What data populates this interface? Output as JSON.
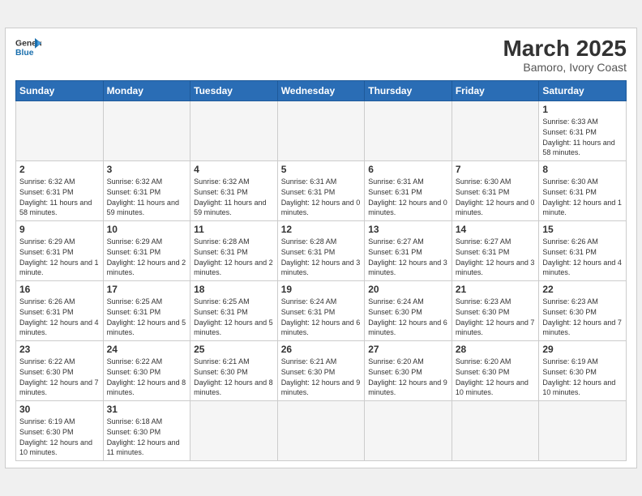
{
  "header": {
    "logo_general": "General",
    "logo_blue": "Blue",
    "month_title": "March 2025",
    "subtitle": "Bamoro, Ivory Coast"
  },
  "days_of_week": [
    "Sunday",
    "Monday",
    "Tuesday",
    "Wednesday",
    "Thursday",
    "Friday",
    "Saturday"
  ],
  "weeks": [
    [
      {
        "day": "",
        "empty": true
      },
      {
        "day": "",
        "empty": true
      },
      {
        "day": "",
        "empty": true
      },
      {
        "day": "",
        "empty": true
      },
      {
        "day": "",
        "empty": true
      },
      {
        "day": "",
        "empty": true
      },
      {
        "day": "1",
        "sunrise": "6:33 AM",
        "sunset": "6:31 PM",
        "daylight": "11 hours and 58 minutes."
      }
    ],
    [
      {
        "day": "2",
        "sunrise": "6:32 AM",
        "sunset": "6:31 PM",
        "daylight": "11 hours and 58 minutes."
      },
      {
        "day": "3",
        "sunrise": "6:32 AM",
        "sunset": "6:31 PM",
        "daylight": "11 hours and 59 minutes."
      },
      {
        "day": "4",
        "sunrise": "6:32 AM",
        "sunset": "6:31 PM",
        "daylight": "11 hours and 59 minutes."
      },
      {
        "day": "5",
        "sunrise": "6:31 AM",
        "sunset": "6:31 PM",
        "daylight": "12 hours and 0 minutes."
      },
      {
        "day": "6",
        "sunrise": "6:31 AM",
        "sunset": "6:31 PM",
        "daylight": "12 hours and 0 minutes."
      },
      {
        "day": "7",
        "sunrise": "6:30 AM",
        "sunset": "6:31 PM",
        "daylight": "12 hours and 0 minutes."
      },
      {
        "day": "8",
        "sunrise": "6:30 AM",
        "sunset": "6:31 PM",
        "daylight": "12 hours and 1 minute."
      }
    ],
    [
      {
        "day": "9",
        "sunrise": "6:29 AM",
        "sunset": "6:31 PM",
        "daylight": "12 hours and 1 minute."
      },
      {
        "day": "10",
        "sunrise": "6:29 AM",
        "sunset": "6:31 PM",
        "daylight": "12 hours and 2 minutes."
      },
      {
        "day": "11",
        "sunrise": "6:28 AM",
        "sunset": "6:31 PM",
        "daylight": "12 hours and 2 minutes."
      },
      {
        "day": "12",
        "sunrise": "6:28 AM",
        "sunset": "6:31 PM",
        "daylight": "12 hours and 3 minutes."
      },
      {
        "day": "13",
        "sunrise": "6:27 AM",
        "sunset": "6:31 PM",
        "daylight": "12 hours and 3 minutes."
      },
      {
        "day": "14",
        "sunrise": "6:27 AM",
        "sunset": "6:31 PM",
        "daylight": "12 hours and 3 minutes."
      },
      {
        "day": "15",
        "sunrise": "6:26 AM",
        "sunset": "6:31 PM",
        "daylight": "12 hours and 4 minutes."
      }
    ],
    [
      {
        "day": "16",
        "sunrise": "6:26 AM",
        "sunset": "6:31 PM",
        "daylight": "12 hours and 4 minutes."
      },
      {
        "day": "17",
        "sunrise": "6:25 AM",
        "sunset": "6:31 PM",
        "daylight": "12 hours and 5 minutes."
      },
      {
        "day": "18",
        "sunrise": "6:25 AM",
        "sunset": "6:31 PM",
        "daylight": "12 hours and 5 minutes."
      },
      {
        "day": "19",
        "sunrise": "6:24 AM",
        "sunset": "6:31 PM",
        "daylight": "12 hours and 6 minutes."
      },
      {
        "day": "20",
        "sunrise": "6:24 AM",
        "sunset": "6:30 PM",
        "daylight": "12 hours and 6 minutes."
      },
      {
        "day": "21",
        "sunrise": "6:23 AM",
        "sunset": "6:30 PM",
        "daylight": "12 hours and 7 minutes."
      },
      {
        "day": "22",
        "sunrise": "6:23 AM",
        "sunset": "6:30 PM",
        "daylight": "12 hours and 7 minutes."
      }
    ],
    [
      {
        "day": "23",
        "sunrise": "6:22 AM",
        "sunset": "6:30 PM",
        "daylight": "12 hours and 7 minutes."
      },
      {
        "day": "24",
        "sunrise": "6:22 AM",
        "sunset": "6:30 PM",
        "daylight": "12 hours and 8 minutes."
      },
      {
        "day": "25",
        "sunrise": "6:21 AM",
        "sunset": "6:30 PM",
        "daylight": "12 hours and 8 minutes."
      },
      {
        "day": "26",
        "sunrise": "6:21 AM",
        "sunset": "6:30 PM",
        "daylight": "12 hours and 9 minutes."
      },
      {
        "day": "27",
        "sunrise": "6:20 AM",
        "sunset": "6:30 PM",
        "daylight": "12 hours and 9 minutes."
      },
      {
        "day": "28",
        "sunrise": "6:20 AM",
        "sunset": "6:30 PM",
        "daylight": "12 hours and 10 minutes."
      },
      {
        "day": "29",
        "sunrise": "6:19 AM",
        "sunset": "6:30 PM",
        "daylight": "12 hours and 10 minutes."
      }
    ],
    [
      {
        "day": "30",
        "sunrise": "6:19 AM",
        "sunset": "6:30 PM",
        "daylight": "12 hours and 10 minutes."
      },
      {
        "day": "31",
        "sunrise": "6:18 AM",
        "sunset": "6:30 PM",
        "daylight": "12 hours and 11 minutes."
      },
      {
        "day": "",
        "empty": true
      },
      {
        "day": "",
        "empty": true
      },
      {
        "day": "",
        "empty": true
      },
      {
        "day": "",
        "empty": true
      },
      {
        "day": "",
        "empty": true
      }
    ]
  ]
}
